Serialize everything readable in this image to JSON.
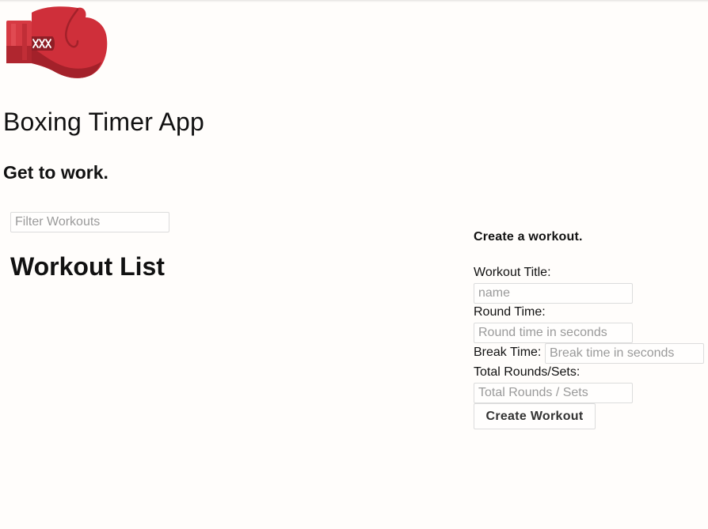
{
  "app": {
    "title": "Boxing Timer App",
    "subtitle": "Get to work."
  },
  "logo": {
    "icon": "boxing-glove-icon",
    "colors": {
      "primary": "#cf2f3a",
      "shade": "#a3212a",
      "cuff": "#d63a43",
      "lace": "#ffffff"
    }
  },
  "filter": {
    "placeholder": "Filter Workouts",
    "value": ""
  },
  "workout_list": {
    "heading": "Workout List",
    "items": []
  },
  "create_form": {
    "heading": "Create a workout.",
    "title_label": "Workout Title:",
    "title_placeholder": "name",
    "round_label": "Round Time:",
    "round_placeholder": "Round time in seconds",
    "break_label": "Break Time:",
    "break_placeholder": "Break time in seconds",
    "rounds_label": "Total Rounds/Sets:",
    "rounds_placeholder": "Total Rounds / Sets",
    "submit_label": "Create Workout"
  }
}
